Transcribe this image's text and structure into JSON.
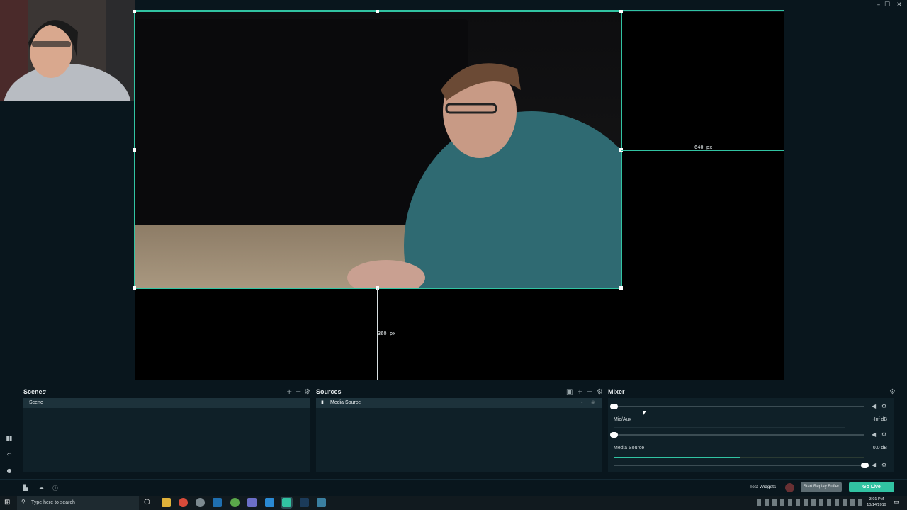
{
  "window": {
    "minimize": "–",
    "maximize": "☐",
    "close": "✕"
  },
  "canvas": {
    "width_label": "640 px",
    "height_label": "360 px"
  },
  "scenes": {
    "title": "Scenes",
    "items": [
      "Scene"
    ]
  },
  "sources": {
    "title": "Sources",
    "items": [
      "Media Source"
    ]
  },
  "mixer": {
    "title": "Mixer",
    "channels": [
      {
        "name": "Mic/Aux",
        "level": "-Inf dB",
        "volume": 0.0
      },
      {
        "name": "Media Source",
        "level": "0.0 dB",
        "volume": 1.0,
        "meter": 0.5
      }
    ]
  },
  "footer": {
    "test_widgets": "Test Widgets",
    "replay_buffer": "Start Replay Buffer",
    "go_live": "Go Live"
  },
  "taskbar": {
    "search_placeholder": "Type here to search",
    "time": "3:01 PM",
    "date": "10/14/2019"
  },
  "colors": {
    "accent": "#31c3a2",
    "panel_bg": "#0f2028",
    "app_bg": "#09161d"
  }
}
